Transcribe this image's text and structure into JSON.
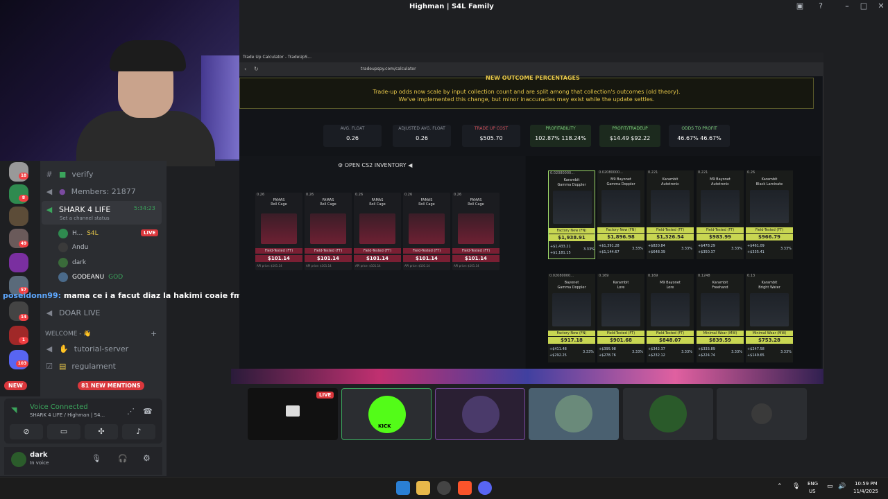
{
  "window": {
    "title": "Highman | S4L Family"
  },
  "sidebar": {
    "server_badges": [
      "18",
      "8",
      "49",
      "57",
      "14",
      "1",
      "103"
    ],
    "channels": [
      {
        "name": "verify"
      },
      {
        "name": "Members: 21877"
      },
      {
        "name": "SHARK 4 LIFE",
        "timer": "5:34:23",
        "status": "Set a channel status"
      }
    ],
    "voice_users": [
      {
        "name": "H...",
        "tag": "S4L",
        "live": "LIVE"
      },
      {
        "name": "Andu"
      },
      {
        "name": "dark"
      },
      {
        "name": "GODEANU",
        "tag": "GOD"
      }
    ],
    "more_channels": [
      "DOAR LIVE",
      "WELCOME - 👋",
      "tutorial-server",
      "regulament"
    ],
    "new_label": "NEW",
    "new_mentions": "81 NEW MENTIONS"
  },
  "chat_overlay": {
    "user": "poseidonn99:",
    "message": "mama ce i a facut diaz la hakimi coaie fmm"
  },
  "voice": {
    "title": "Voice Connected",
    "subtitle": "SHARK 4 LIFE / Highman | S4...",
    "user": "dark",
    "user_status": "In voice"
  },
  "browser": {
    "tab_title": "Trade Up Calculator - TradeUpS...",
    "url": "tradeupspy.com/calculator",
    "notice_head": "NEW OUTCOME PERCENTAGES",
    "notice_line1": "Trade-up odds now scale by input collection count and are split among that collection's outcomes (old theory).",
    "notice_line2": "We've implemented this change, but minor inaccuracies may exist while the update settles.",
    "stats": [
      {
        "label": "AVG. FLOAT",
        "value": "0.26"
      },
      {
        "label": "ADJUSTED AVG. FLOAT",
        "value": "0.26"
      },
      {
        "label": "TRADE UP COST",
        "value": "$505.70"
      },
      {
        "label": "PROFITABILITY",
        "value": "102.87%   118.24%"
      },
      {
        "label": "PROFIT/TRADEUP",
        "value": "$14.49   $92.22"
      },
      {
        "label": "ODDS TO PROFIT",
        "value": "46.67%   46.67%"
      }
    ],
    "inventory_button": "OPEN CS2 INVENTORY",
    "inputs": [
      {
        "float": "0.26",
        "name": "FAMAS\nRoll Cage",
        "wear": "Field-Tested (FT)",
        "price": "$101.14",
        "api": "API price: $101.14"
      },
      {
        "float": "0.26",
        "name": "FAMAS\nRoll Cage",
        "wear": "Field-Tested (FT)",
        "price": "$101.14",
        "api": "API price: $101.14"
      },
      {
        "float": "0.26",
        "name": "FAMAS\nRoll Cage",
        "wear": "Field-Tested (FT)",
        "price": "$101.14",
        "api": "API price: $101.14"
      },
      {
        "float": "0.26",
        "name": "FAMAS\nRoll Cage",
        "wear": "Field-Tested (FT)",
        "price": "$101.14",
        "api": "API price: $101.14"
      },
      {
        "float": "0.26",
        "name": "FAMAS\nRoll Cage",
        "wear": "Field-Tested (FT)",
        "price": "$101.14",
        "api": "API price: $101.14"
      }
    ],
    "outcomes": [
      {
        "float": "0.02080000...",
        "name": "Karambit\nGamma Doppler",
        "wear": "Factory New (FN)",
        "price": "$1,938.91",
        "p1": "+$1,433.21",
        "p2": "+$1,181.15",
        "pct": "3.33%"
      },
      {
        "float": "0.02080000...",
        "name": "M9 Bayonet\nGamma Doppler",
        "wear": "Factory New (FN)",
        "price": "$1,896.98",
        "p1": "+$1,391.28",
        "p2": "+$1,144.67",
        "pct": "3.33%"
      },
      {
        "float": "0.221",
        "name": "Karambit\nAutotronic",
        "wear": "Field-Tested (FT)",
        "price": "$1,326.54",
        "p1": "+$820.84",
        "p2": "+$648.39",
        "pct": "3.33%"
      },
      {
        "float": "0.221",
        "name": "M9 Bayonet\nAutotronic",
        "wear": "Field-Tested (FT)",
        "price": "$983.99",
        "p1": "+$478.29",
        "p2": "+$350.37",
        "pct": "3.33%"
      },
      {
        "float": "0.26",
        "name": "Karambit\nBlack Laminate",
        "wear": "Field-Tested (FT)",
        "price": "$966.79",
        "p1": "+$461.09",
        "p2": "+$335.41",
        "pct": "3.33%"
      },
      {
        "float": "0.02080000...",
        "name": "Bayonet\nGamma Doppler",
        "wear": "Factory New (FN)",
        "price": "$917.18",
        "p1": "+$411.48",
        "p2": "+$292.25",
        "pct": "3.33%"
      },
      {
        "float": "0.169",
        "name": "Karambit\nLore",
        "wear": "Field-Tested (FT)",
        "price": "$901.68",
        "p1": "+$395.98",
        "p2": "+$278.76",
        "pct": "3.33%"
      },
      {
        "float": "0.169",
        "name": "M9 Bayonet\nLore",
        "wear": "Field-Tested (FT)",
        "price": "$848.07",
        "p1": "+$342.37",
        "p2": "+$232.12",
        "pct": "3.33%"
      },
      {
        "float": "0.1248",
        "name": "Karambit\nFreehand",
        "wear": "Minimal Wear (MW)",
        "price": "$839.59",
        "p1": "+$333.89",
        "p2": "+$224.74",
        "pct": "3.33%"
      },
      {
        "float": "0.13",
        "name": "Karambit\nBright Water",
        "wear": "Minimal Wear (MW)",
        "price": "$753.28",
        "p1": "+$247.58",
        "p2": "+$149.65",
        "pct": "3.33%"
      }
    ]
  },
  "stream_tiles": {
    "live": "LIVE",
    "kick_label": "KICK"
  },
  "taskbar": {
    "lang1": "ENG",
    "lang2": "US",
    "time": "10:59 PM",
    "date": "11/4/2025"
  },
  "colors": {
    "accent_green": "#3ba55c",
    "danger": "#da373c",
    "gold": "#e8c84a",
    "outcome_bg": "#c8d652",
    "input_bg": "#7a1f33"
  }
}
